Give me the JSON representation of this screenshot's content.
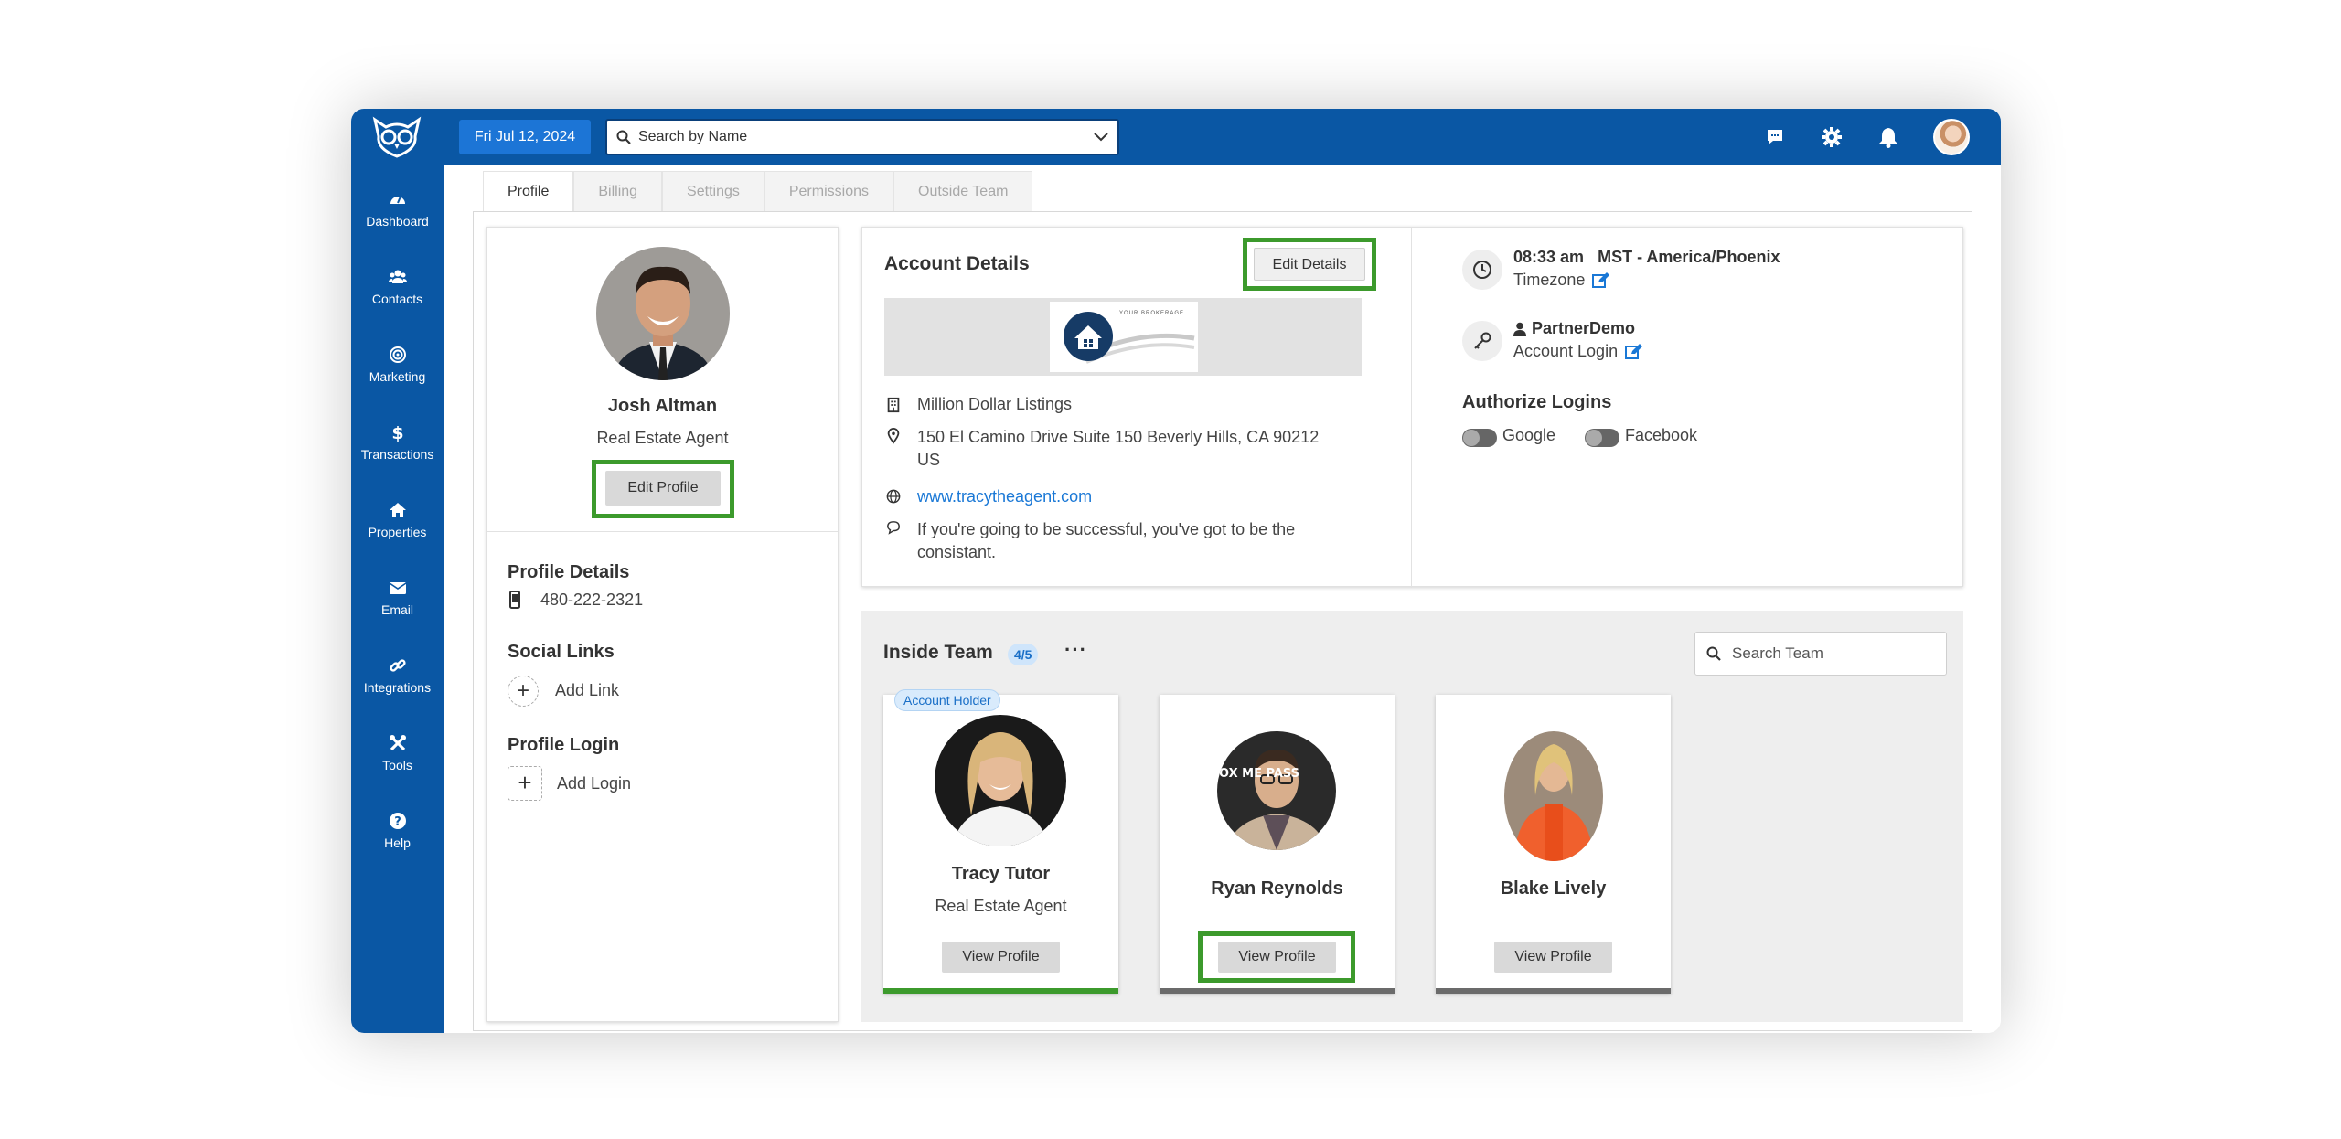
{
  "topbar": {
    "date": "Fri Jul 12, 2024",
    "search_placeholder": "Search by Name"
  },
  "sidebar": {
    "items": [
      {
        "label": "Dashboard",
        "icon": "dashboard-icon"
      },
      {
        "label": "Contacts",
        "icon": "contacts-icon"
      },
      {
        "label": "Marketing",
        "icon": "marketing-icon"
      },
      {
        "label": "Transactions",
        "icon": "dollar-icon"
      },
      {
        "label": "Properties",
        "icon": "home-icon"
      },
      {
        "label": "Email",
        "icon": "envelope-icon"
      },
      {
        "label": "Integrations",
        "icon": "link-icon"
      },
      {
        "label": "Tools",
        "icon": "tools-icon"
      },
      {
        "label": "Help",
        "icon": "help-icon"
      }
    ]
  },
  "tabs": [
    "Profile",
    "Billing",
    "Settings",
    "Permissions",
    "Outside Team"
  ],
  "profile": {
    "name": "Josh Altman",
    "title": "Real Estate Agent",
    "edit_button": "Edit Profile",
    "details_title": "Profile Details",
    "phone": "480-222-2321",
    "social_title": "Social Links",
    "add_link": "Add Link",
    "login_title": "Profile Login",
    "add_login": "Add Login"
  },
  "account": {
    "title": "Account Details",
    "edit_button": "Edit Details",
    "company": "Million Dollar Listings",
    "address_line1": "150 El Camino Drive Suite 150 Beverly Hills, CA 90212",
    "address_line2": "US",
    "website": "www.tracytheagent.com",
    "motto_line1": "If you're going to be successful, you've got to be the",
    "motto_line2": "consistant.",
    "logo_text": "YOUR BROKERAGE",
    "time": "08:33 am",
    "timezone_name": "MST - America/Phoenix",
    "timezone_label": "Timezone",
    "login_user": "PartnerDemo",
    "login_label": "Account Login",
    "authorize_title": "Authorize Logins",
    "google_label": "Google",
    "facebook_label": "Facebook"
  },
  "team": {
    "title": "Inside Team",
    "count": "4/5",
    "more": "···",
    "search_placeholder": "Search Team",
    "holder_badge": "Account Holder",
    "members": [
      {
        "name": "Tracy Tutor",
        "role": "Real Estate Agent",
        "button": "View Profile"
      },
      {
        "name": "Ryan Reynolds",
        "role": "",
        "button": "View Profile",
        "photo_text": "OX ME PASS"
      },
      {
        "name": "Blake Lively",
        "role": "",
        "button": "View Profile"
      }
    ]
  },
  "colors": {
    "primary": "#0a57a4",
    "highlight": "#3c9a2c",
    "link": "#1a78d6"
  }
}
